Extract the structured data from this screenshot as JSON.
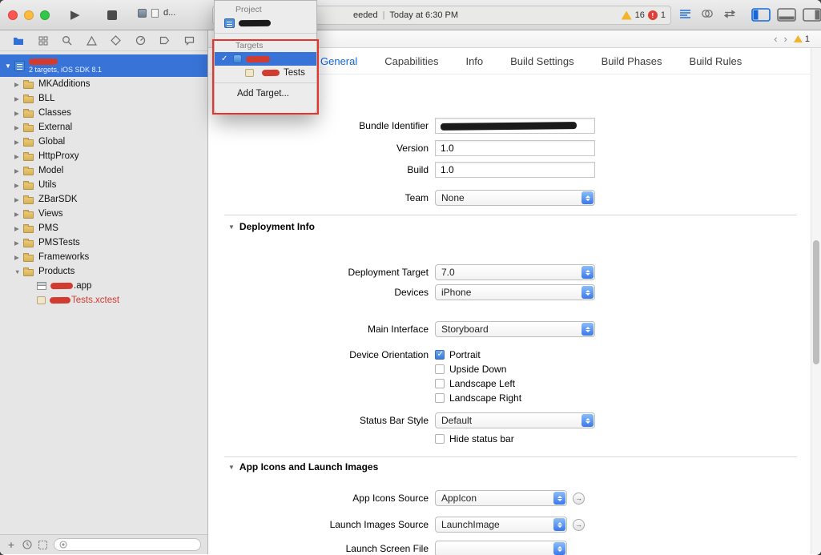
{
  "icons": {
    "play": "▶",
    "check": "✓",
    "plus": "+",
    "back_chevron": "‹",
    "forward_chevron": "›",
    "round_arrow": "→"
  },
  "toolbar": {
    "scheme_text": "d...",
    "status_text": "eeded",
    "status_separator": "|",
    "status_time": "Today at 6:30 PM",
    "warning_count": "16",
    "error_count": "1"
  },
  "popover": {
    "project_section_label": "Project",
    "targets_section_label": "Targets",
    "target_tests_suffix": "Tests",
    "add_target_label": "Add Target..."
  },
  "sidebar": {
    "project_subtitle": "2 targets, iOS SDK 8.1",
    "tree": [
      {
        "label": "MKAdditions"
      },
      {
        "label": "BLL"
      },
      {
        "label": "Classes"
      },
      {
        "label": "External"
      },
      {
        "label": "Global"
      },
      {
        "label": "HttpProxy"
      },
      {
        "label": "Model"
      },
      {
        "label": "Utils"
      },
      {
        "label": "ZBarSDK"
      },
      {
        "label": "Views"
      },
      {
        "label": "PMS"
      },
      {
        "label": "PMSTests"
      },
      {
        "label": "Frameworks"
      },
      {
        "label": "Products"
      }
    ],
    "products": [
      {
        "suffix": ".app"
      },
      {
        "suffix": "Tests.xctest"
      }
    ]
  },
  "editor": {
    "jumpbar": {
      "warning_count": "1"
    },
    "tabs": [
      {
        "label": "General",
        "selected": true
      },
      {
        "label": "Capabilities"
      },
      {
        "label": "Info"
      },
      {
        "label": "Build Settings"
      },
      {
        "label": "Build Phases"
      },
      {
        "label": "Build Rules"
      }
    ],
    "form": {
      "bundle_identifier_label": "Bundle Identifier",
      "version_label": "Version",
      "version_value": "1.0",
      "build_label": "Build",
      "build_value": "1.0",
      "team_label": "Team",
      "team_value": "None",
      "deployment_header": "Deployment Info",
      "deployment_target_label": "Deployment Target",
      "deployment_target_value": "7.0",
      "devices_label": "Devices",
      "devices_value": "iPhone",
      "main_interface_label": "Main Interface",
      "main_interface_value": "Storyboard",
      "device_orientation_label": "Device Orientation",
      "orientations": [
        {
          "label": "Portrait",
          "checked": true
        },
        {
          "label": "Upside Down",
          "checked": false
        },
        {
          "label": "Landscape Left",
          "checked": false
        },
        {
          "label": "Landscape Right",
          "checked": false
        }
      ],
      "status_bar_style_label": "Status Bar Style",
      "status_bar_style_value": "Default",
      "hide_status_bar_label": "Hide status bar",
      "hide_status_bar_checked": false,
      "app_icons_header": "App Icons and Launch Images",
      "app_icons_source_label": "App Icons Source",
      "app_icons_source_value": "AppIcon",
      "launch_images_source_label": "Launch Images Source",
      "launch_images_source_value": "LaunchImage",
      "launch_screen_file_label": "Launch Screen File",
      "launch_screen_file_value": ""
    }
  },
  "colors": {
    "selection_blue": "#3874d8",
    "accent_blue": "#1467d6",
    "redaction_red": "#d23c30",
    "warning_yellow": "#f3b32b",
    "error_red": "#dd4038"
  }
}
